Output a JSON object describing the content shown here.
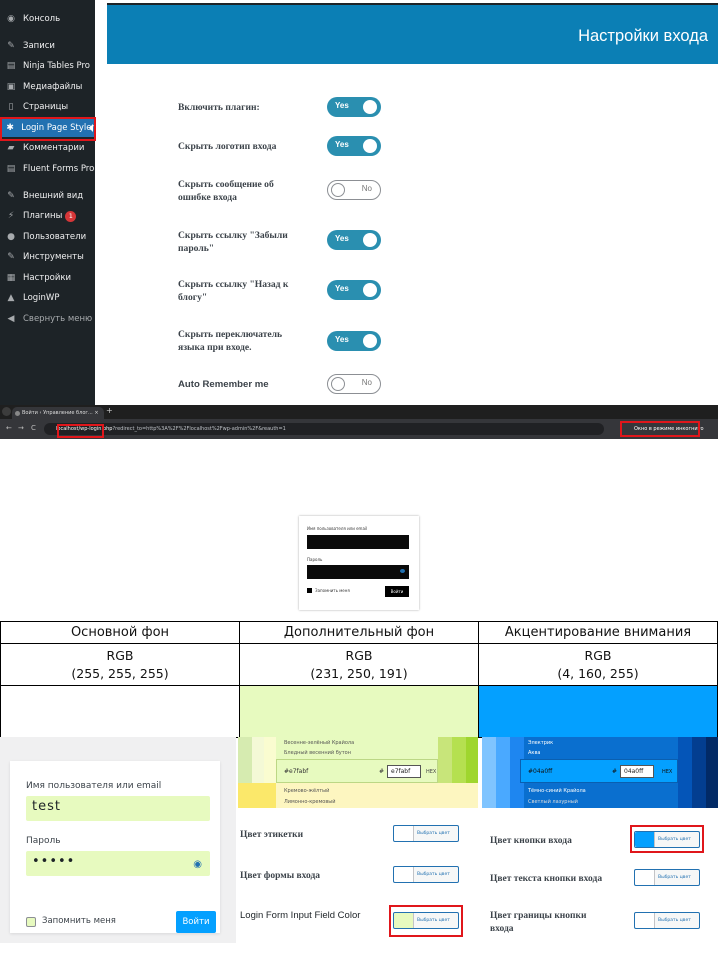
{
  "sidebar": {
    "items": [
      {
        "label": "Консоль",
        "icon": "dashboard-icon",
        "glyph": "◉"
      },
      {
        "label": "Записи",
        "icon": "pin-icon",
        "glyph": "✎"
      },
      {
        "label": "Ninja Tables Pro",
        "icon": "table-icon",
        "glyph": "▤"
      },
      {
        "label": "Медиафайлы",
        "icon": "media-icon",
        "glyph": "▣"
      },
      {
        "label": "Страницы",
        "icon": "page-icon",
        "glyph": "▯"
      },
      {
        "label": "Login Page Styler",
        "icon": "gear-icon",
        "glyph": "✱"
      },
      {
        "label": "Комментарии",
        "icon": "comment-icon",
        "glyph": "▰"
      },
      {
        "label": "Fluent Forms Pro",
        "icon": "form-icon",
        "glyph": "▤"
      },
      {
        "label": "Внешний вид",
        "icon": "brush-icon",
        "glyph": "✎"
      },
      {
        "label": "Плагины",
        "icon": "plugin-icon",
        "glyph": "⚡",
        "badge": "1"
      },
      {
        "label": "Пользователи",
        "icon": "user-icon",
        "glyph": "●"
      },
      {
        "label": "Инструменты",
        "icon": "wrench-icon",
        "glyph": "✎"
      },
      {
        "label": "Настройки",
        "icon": "settings-icon",
        "glyph": "▦"
      },
      {
        "label": "LoginWP",
        "icon": "home-icon",
        "glyph": "▲"
      },
      {
        "label": "Свернуть меню",
        "icon": "collapse-icon",
        "glyph": "◀"
      }
    ]
  },
  "banner": {
    "title": "Настройки входа"
  },
  "settings": [
    {
      "label": "Включить плагин:",
      "state": "Yes"
    },
    {
      "label": "Скрыть логотип входа",
      "state": "Yes"
    },
    {
      "label": "Скрыть сообщение об ошибке входа",
      "state": "No"
    },
    {
      "label": "Скрыть ссылку \"Забыли пароль\"",
      "state": "Yes"
    },
    {
      "label": "Скрыть ссылку \"Назад к блогу\"",
      "state": "Yes"
    },
    {
      "label": "Скрыть переключатель языка при входе.",
      "state": "Yes"
    },
    {
      "label": "Auto Remember me",
      "state": "No"
    }
  ],
  "browser": {
    "tab_title": "Войти ‹ Управление блог... ×",
    "tab_close": "×",
    "new_tab": "+",
    "nav_back": "←",
    "nav_forward": "→",
    "nav_reload": "C",
    "url_host": "localhost/wp-login.php",
    "url_rest": "?redirect_to=http%3A%2F%2Flocalhost%2Fwp-admin%2F&reauth=1",
    "incognito": "Окно в режиме инкогнито"
  },
  "mini_login": {
    "username_label": "Имя пользователя или email",
    "password_label": "Пароль",
    "remember_label": "Запомнить меня",
    "submit": "Войти"
  },
  "color_table": {
    "headers": [
      "Основной фон",
      "Дополнительный фон",
      "Акцентирование внимания"
    ],
    "models": [
      "RGB",
      "RGB",
      "RGB"
    ],
    "values": [
      "(255, 255, 255)",
      "(231, 250, 191)",
      "(4, 160, 255)"
    ],
    "colors": [
      "#ffffff",
      "#e7fabf",
      "#04a0ff"
    ]
  },
  "login_form": {
    "username_label": "Имя пользователя или email",
    "username_value": "test",
    "password_label": "Пароль",
    "password_value": "•••••",
    "remember_label": "Запомнить меня",
    "submit": "Войти"
  },
  "picker1": {
    "rows": [
      "Весенне-зелёный Крайола",
      "Бледный весенний бутон",
      "Кремово-жёлтый",
      "Лимонно-кремовый"
    ],
    "hex_left": "#e7fabf",
    "hex_prefix": "#",
    "hex_value": "e7fabf",
    "mode": "HEX"
  },
  "picker2": {
    "rows": [
      "Электрик",
      "Аква",
      "Тёмно-синий Крайола",
      "Светлый лазурный"
    ],
    "hex_left": "#04a0ff",
    "hex_prefix": "#",
    "hex_value": "04a0ff",
    "mode": "HEX"
  },
  "color_settings": {
    "choose_label": "Выбрать цвет",
    "items": [
      {
        "label": "Цвет этикетки",
        "swatch": "#ffffff"
      },
      {
        "label": "Цвет формы входа",
        "swatch": "#ffffff"
      },
      {
        "label": "Login Form Input Field Color",
        "swatch": "#e7fabf"
      },
      {
        "label": "Цвет кнопки входа",
        "swatch": "#04a0ff"
      },
      {
        "label": "Цвет текста кнопки входа",
        "swatch": "#ffffff"
      },
      {
        "label": "Цвет границы кнопки входа",
        "swatch": "#ffffff"
      }
    ]
  },
  "colors": {
    "sidebar": "#1d2327",
    "active": "#2271b1",
    "banner": "#0b7fb5",
    "toggle_on": "#2a8fb0",
    "highlight": "#e0161b"
  }
}
